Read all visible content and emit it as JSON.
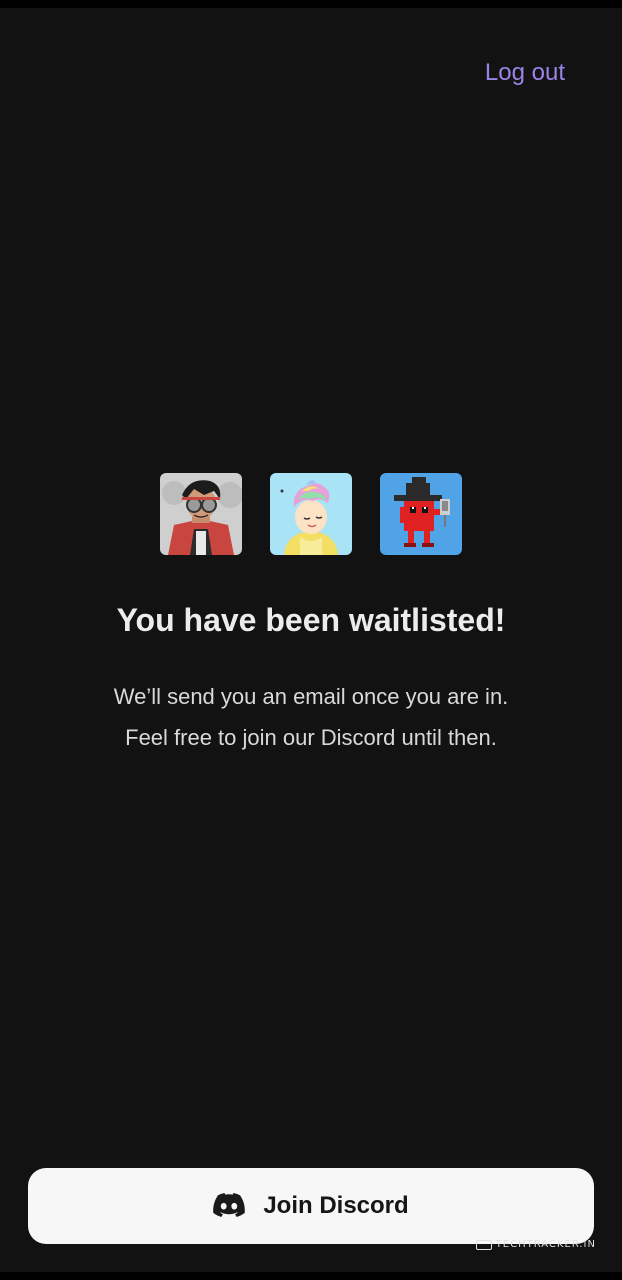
{
  "header": {
    "logout_label": "Log out"
  },
  "avatars": [
    {
      "icon": "goggles-character-avatar-icon"
    },
    {
      "icon": "rainbow-swirl-character-avatar-icon"
    },
    {
      "icon": "red-witch-character-avatar-icon"
    }
  ],
  "main": {
    "title": "You have been waitlisted!",
    "line1": "We’ll send you an email once you are in.",
    "line2": "Feel free to join our Discord until then."
  },
  "footer": {
    "discord_button_label": "Join Discord",
    "discord_icon": "discord-logo-icon",
    "watermark": "TECHTRACKER.IN"
  },
  "colors": {
    "background": "#121212",
    "accent": "#9a83e6",
    "button_bg": "#f7f7f7"
  }
}
